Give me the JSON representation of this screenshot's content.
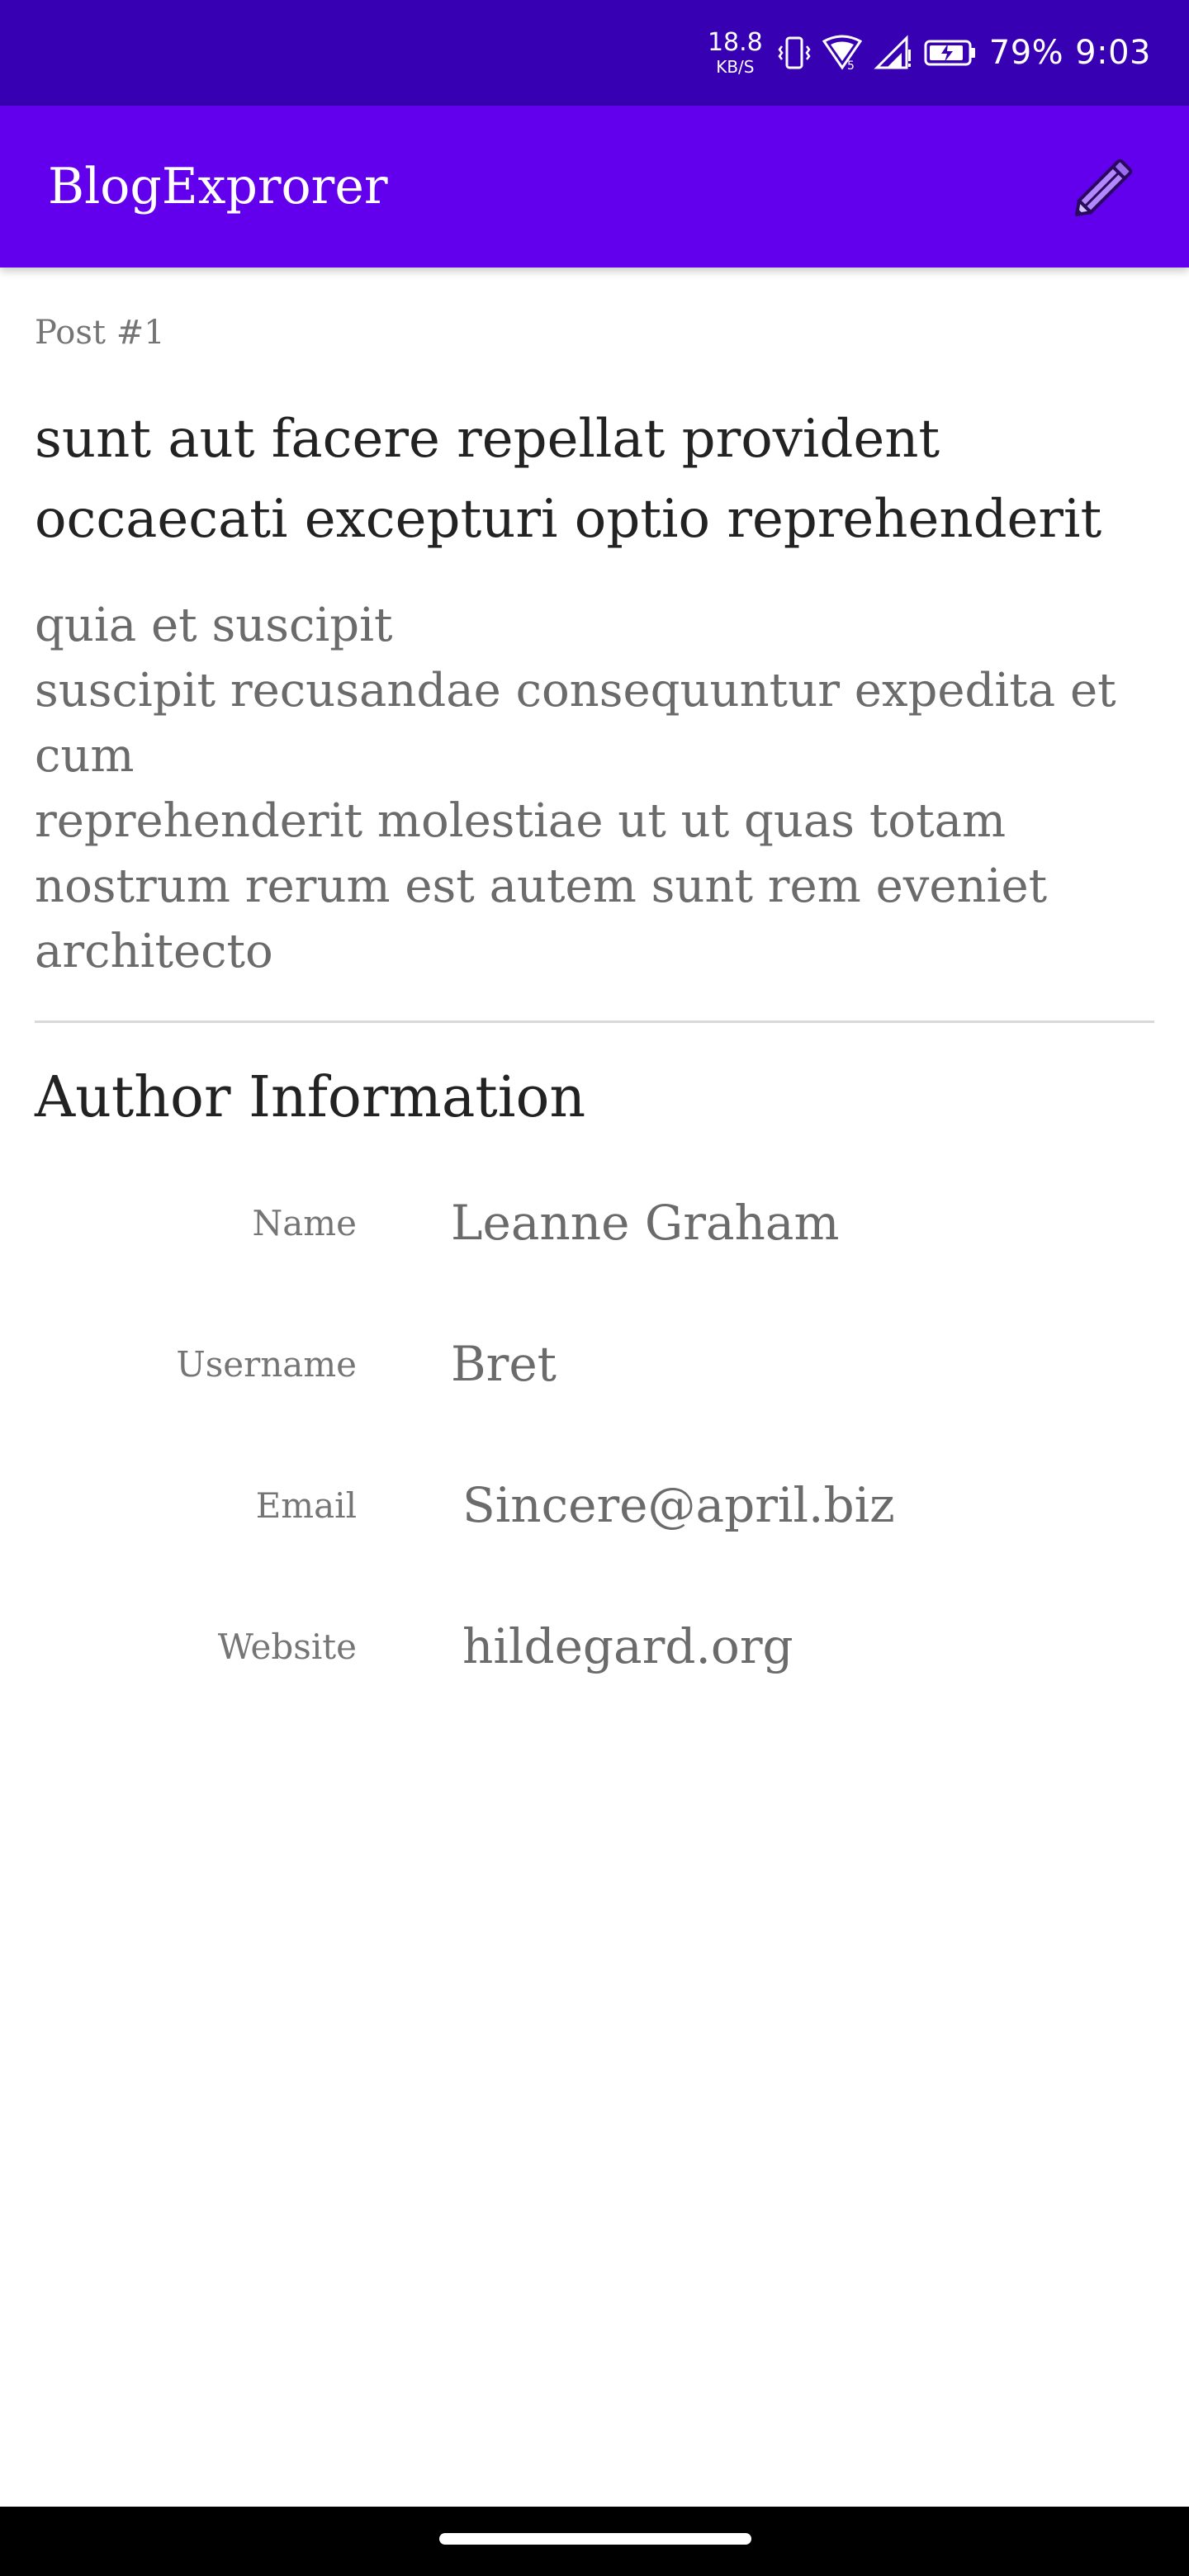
{
  "status_bar": {
    "net_speed_value": "18.8",
    "net_speed_unit": "KB/S",
    "battery_percent": "79%",
    "time": "9:03"
  },
  "app_bar": {
    "title": "BlogExprorer",
    "edit_icon": "pencil-icon"
  },
  "post": {
    "label": "Post #1",
    "title": "sunt aut facere repellat provident occaecati excepturi optio reprehenderit",
    "body": "quia et suscipit\nsuscipit recusandae consequuntur expedita et cum\nreprehenderit molestiae ut ut quas totam\nnostrum rerum est autem sunt rem eveniet architecto"
  },
  "author": {
    "section_title": "Author Information",
    "fields": [
      {
        "label": "Name",
        "value": "Leanne Graham"
      },
      {
        "label": "Username",
        "value": "Bret"
      },
      {
        "label": "Email",
        "value": "Sincere@april.biz"
      },
      {
        "label": "Website",
        "value": "hildegard.org"
      }
    ]
  },
  "colors": {
    "status_bar": "#3700B3",
    "app_bar": "#6200EE",
    "pencil": "#B388FF"
  }
}
